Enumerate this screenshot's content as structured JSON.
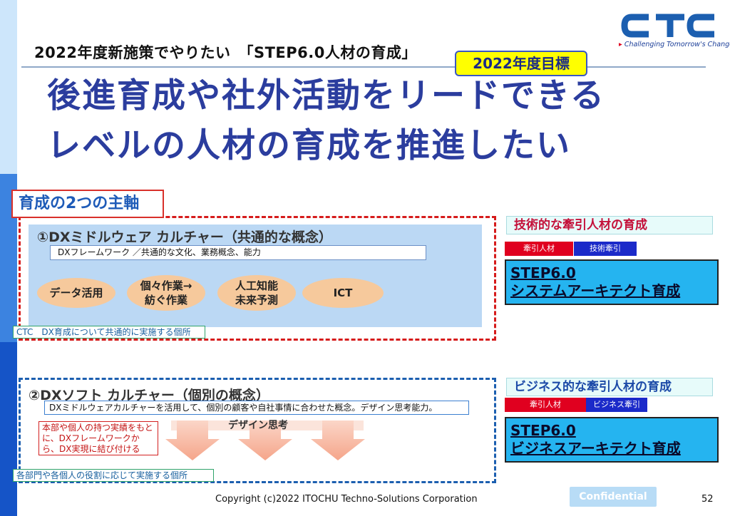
{
  "slide": {
    "subtitle": "2022年度新施策でやりたい　「STEP6.0人材の育成」",
    "goal_badge": "2022年度目標",
    "headline_line1": "後進育成や社外活動をリードできる",
    "headline_line2": "レベルの人材の育成を推進したい",
    "logo": {
      "name": "CTC",
      "tagline": "Challenging Tomorrow's Changes",
      "color": "#1c5fb0",
      "accent_color": "#e0001f"
    }
  },
  "axes": {
    "label": "育成の2つの主軸",
    "dx1": {
      "title": "①DXミドルウェア カルチャー（共通的な概念）",
      "note": "DXフレームワーク ／共通的な文化、業務概念、能力",
      "ovals": [
        "データ活用",
        "個々作業→\n紡ぐ作業",
        "人工知能\n未来予測",
        "ICT"
      ],
      "footer": "CTC　DX育成について共通的に実施する個所"
    },
    "dx2": {
      "title": "②DXソフト カルチャー（個別の概念）",
      "note": "DXミドルウェアカルチャーを活用して、個別の顧客や自社事情に合わせた概念。デザイン思考能力。",
      "design_label": "デザイン思考",
      "red_note": "本部や個人の持つ実績をもとに、DXフレームワークから、DX実現に結び付ける",
      "footer": "各部門や各個人の役割に応じて実施する個所"
    }
  },
  "right": {
    "tech": {
      "heading": "技術的な牽引人材の育成",
      "tag_red": "牽引人材",
      "tag_blue": "技術牽引",
      "step_line1": "STEP6.0",
      "step_line2": "システムアーキテクト育成"
    },
    "biz": {
      "heading": "ビジネス的な牽引人材の育成",
      "tag_red": "牽引人材",
      "tag_blue": "ビジネス牽引",
      "step_line1": "STEP6.0",
      "step_line2": "ビジネスアーキテクト育成"
    }
  },
  "footer": {
    "copyright": "Copyright (c)2022 ITOCHU Techno-Solutions Corporation",
    "confidential": "Confidential",
    "page_number": "52"
  }
}
